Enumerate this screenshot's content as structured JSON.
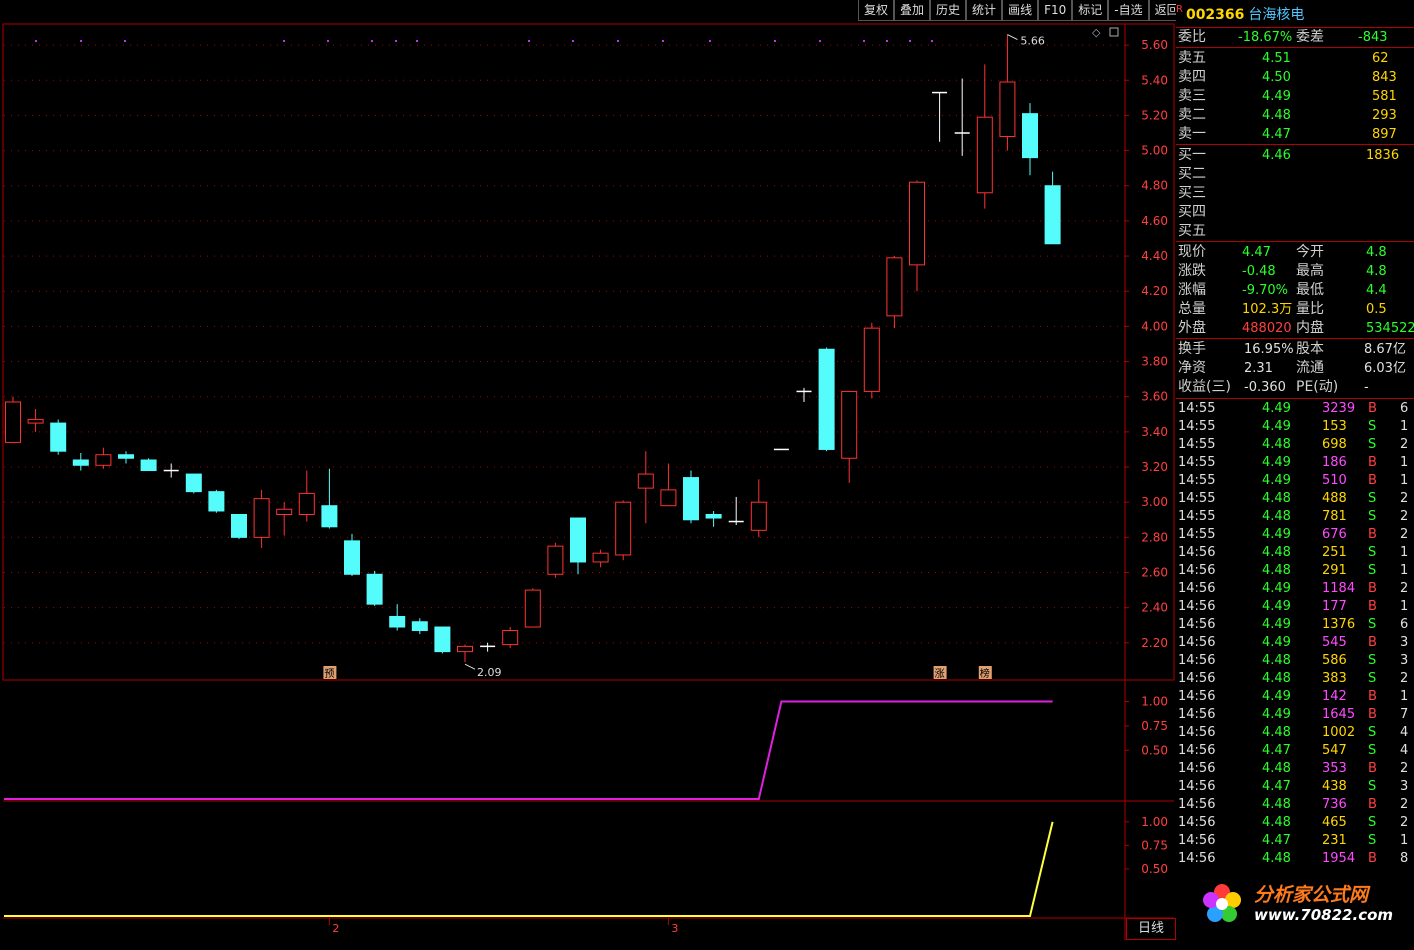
{
  "toolbar": [
    "复权",
    "叠加",
    "历史",
    "统计",
    "画线",
    "F10",
    "标记",
    "-自选",
    "返回"
  ],
  "stock": {
    "tag": "R",
    "code": "002366",
    "name": "台海核电"
  },
  "quote": {
    "weibi_label": "委比",
    "weibi": "-18.67%",
    "weicha_label": "委差",
    "weicha": "-843",
    "asks": [
      {
        "label": "卖五",
        "price": "4.51",
        "vol": "62"
      },
      {
        "label": "卖四",
        "price": "4.50",
        "vol": "843"
      },
      {
        "label": "卖三",
        "price": "4.49",
        "vol": "581"
      },
      {
        "label": "卖二",
        "price": "4.48",
        "vol": "293"
      },
      {
        "label": "卖一",
        "price": "4.47",
        "vol": "897"
      }
    ],
    "bids": [
      {
        "label": "买一",
        "price": "4.46",
        "vol": "1836"
      },
      {
        "label": "买二",
        "price": "",
        "vol": ""
      },
      {
        "label": "买三",
        "price": "",
        "vol": ""
      },
      {
        "label": "买四",
        "price": "",
        "vol": ""
      },
      {
        "label": "买五",
        "price": "",
        "vol": ""
      }
    ],
    "stats": [
      {
        "l1": "现价",
        "v1": "4.47",
        "c1": "g",
        "l2": "今开",
        "v2": "4.8",
        "c2": "g"
      },
      {
        "l1": "涨跌",
        "v1": "-0.48",
        "c1": "g",
        "l2": "最高",
        "v2": "4.8",
        "c2": "g"
      },
      {
        "l1": "涨幅",
        "v1": "-9.70%",
        "c1": "g",
        "l2": "最低",
        "v2": "4.4",
        "c2": "g"
      },
      {
        "l1": "总量",
        "v1": "102.3万",
        "c1": "y",
        "l2": "量比",
        "v2": "0.5",
        "c2": "y"
      },
      {
        "l1": "外盘",
        "v1": "488020",
        "c1": "r",
        "l2": "内盘",
        "v2": "534522",
        "c2": "g"
      }
    ],
    "stats2": [
      {
        "l1": "换手",
        "v1": "16.95%",
        "l2": "股本",
        "v2": "8.67亿"
      },
      {
        "l1": "净资",
        "v1": "2.31",
        "l2": "流通",
        "v2": "6.03亿"
      },
      {
        "l1": "收益(三)",
        "v1": "-0.360",
        "l2": "PE(动)",
        "v2": "-"
      }
    ]
  },
  "ticks": [
    {
      "t": "14:55",
      "p": "4.49",
      "v": "3239",
      "d": "B",
      "n": "6"
    },
    {
      "t": "14:55",
      "p": "4.49",
      "v": "153",
      "d": "S",
      "n": "1"
    },
    {
      "t": "14:55",
      "p": "4.48",
      "v": "698",
      "d": "S",
      "n": "2"
    },
    {
      "t": "14:55",
      "p": "4.49",
      "v": "186",
      "d": "B",
      "n": "1"
    },
    {
      "t": "14:55",
      "p": "4.49",
      "v": "510",
      "d": "B",
      "n": "1"
    },
    {
      "t": "14:55",
      "p": "4.48",
      "v": "488",
      "d": "S",
      "n": "2"
    },
    {
      "t": "14:55",
      "p": "4.48",
      "v": "781",
      "d": "S",
      "n": "2"
    },
    {
      "t": "14:55",
      "p": "4.49",
      "v": "676",
      "d": "B",
      "n": "2"
    },
    {
      "t": "14:56",
      "p": "4.48",
      "v": "251",
      "d": "S",
      "n": "1"
    },
    {
      "t": "14:56",
      "p": "4.48",
      "v": "291",
      "d": "S",
      "n": "1"
    },
    {
      "t": "14:56",
      "p": "4.49",
      "v": "1184",
      "d": "B",
      "n": "2"
    },
    {
      "t": "14:56",
      "p": "4.49",
      "v": "177",
      "d": "B",
      "n": "1"
    },
    {
      "t": "14:56",
      "p": "4.49",
      "v": "1376",
      "d": "S",
      "n": "6"
    },
    {
      "t": "14:56",
      "p": "4.49",
      "v": "545",
      "d": "B",
      "n": "3"
    },
    {
      "t": "14:56",
      "p": "4.48",
      "v": "586",
      "d": "S",
      "n": "3"
    },
    {
      "t": "14:56",
      "p": "4.48",
      "v": "383",
      "d": "S",
      "n": "2"
    },
    {
      "t": "14:56",
      "p": "4.49",
      "v": "142",
      "d": "B",
      "n": "1"
    },
    {
      "t": "14:56",
      "p": "4.49",
      "v": "1645",
      "d": "B",
      "n": "7"
    },
    {
      "t": "14:56",
      "p": "4.48",
      "v": "1002",
      "d": "S",
      "n": "4"
    },
    {
      "t": "14:56",
      "p": "4.47",
      "v": "547",
      "d": "S",
      "n": "4"
    },
    {
      "t": "14:56",
      "p": "4.48",
      "v": "353",
      "d": "B",
      "n": "2"
    },
    {
      "t": "14:56",
      "p": "4.47",
      "v": "438",
      "d": "S",
      "n": "3"
    },
    {
      "t": "14:56",
      "p": "4.48",
      "v": "736",
      "d": "B",
      "n": "2"
    },
    {
      "t": "14:56",
      "p": "4.48",
      "v": "465",
      "d": "S",
      "n": "2"
    },
    {
      "t": "14:56",
      "p": "4.47",
      "v": "231",
      "d": "S",
      "n": "1"
    },
    {
      "t": "14:56",
      "p": "4.48",
      "v": "1954",
      "d": "B",
      "n": "8"
    }
  ],
  "logo": {
    "text": "分析家公式网",
    "url": "www.70822.com"
  },
  "colors": {
    "up": "#ff3232",
    "down": "#54fcfc",
    "grid": "#b00000",
    "magenta": "#e020e0",
    "yellow": "#ffff40"
  },
  "markers": [
    "预",
    "涨",
    "榜"
  ],
  "day_label": "日线",
  "chart_data": {
    "type": "candlestick",
    "ylim": [
      2.0,
      5.72
    ],
    "y_ticks": [
      "5.60",
      "5.40",
      "5.20",
      "5.00",
      "4.80",
      "4.60",
      "4.40",
      "4.20",
      "4.00",
      "3.80",
      "3.60",
      "3.40",
      "3.20",
      "3.00",
      "2.80",
      "2.60",
      "2.40",
      "2.20"
    ],
    "annotations": {
      "high": "5.66",
      "low": "2.09"
    },
    "x_labels": [
      "2",
      "3"
    ],
    "candles": [
      {
        "o": 3.34,
        "h": 3.6,
        "l": 3.34,
        "c": 3.57
      },
      {
        "o": 3.45,
        "h": 3.53,
        "l": 3.4,
        "c": 3.47
      },
      {
        "o": 3.45,
        "h": 3.47,
        "l": 3.27,
        "c": 3.29
      },
      {
        "o": 3.24,
        "h": 3.28,
        "l": 3.18,
        "c": 3.21
      },
      {
        "o": 3.21,
        "h": 3.31,
        "l": 3.19,
        "c": 3.27
      },
      {
        "o": 3.27,
        "h": 3.29,
        "l": 3.22,
        "c": 3.25
      },
      {
        "o": 3.24,
        "h": 3.25,
        "l": 3.18,
        "c": 3.18
      },
      {
        "o": 3.18,
        "h": 3.22,
        "l": 3.14,
        "c": 3.18
      },
      {
        "o": 3.16,
        "h": 3.16,
        "l": 3.05,
        "c": 3.06
      },
      {
        "o": 3.06,
        "h": 3.07,
        "l": 2.94,
        "c": 2.95
      },
      {
        "o": 2.93,
        "h": 2.93,
        "l": 2.79,
        "c": 2.8
      },
      {
        "o": 2.8,
        "h": 3.07,
        "l": 2.74,
        "c": 3.02
      },
      {
        "o": 2.93,
        "h": 3.0,
        "l": 2.81,
        "c": 2.96
      },
      {
        "o": 2.93,
        "h": 3.18,
        "l": 2.89,
        "c": 3.05
      },
      {
        "o": 2.98,
        "h": 3.19,
        "l": 2.85,
        "c": 2.86
      },
      {
        "o": 2.78,
        "h": 2.82,
        "l": 2.58,
        "c": 2.59
      },
      {
        "o": 2.59,
        "h": 2.61,
        "l": 2.41,
        "c": 2.42
      },
      {
        "o": 2.35,
        "h": 2.42,
        "l": 2.27,
        "c": 2.29
      },
      {
        "o": 2.32,
        "h": 2.34,
        "l": 2.25,
        "c": 2.27
      },
      {
        "o": 2.29,
        "h": 2.29,
        "l": 2.14,
        "c": 2.15
      },
      {
        "o": 2.15,
        "h": 2.19,
        "l": 2.09,
        "c": 2.18
      },
      {
        "o": 2.17,
        "h": 2.2,
        "l": 2.15,
        "c": 2.18
      },
      {
        "o": 2.19,
        "h": 2.29,
        "l": 2.17,
        "c": 2.27
      },
      {
        "o": 2.29,
        "h": 2.51,
        "l": 2.29,
        "c": 2.5
      },
      {
        "o": 2.59,
        "h": 2.77,
        "l": 2.57,
        "c": 2.75
      },
      {
        "o": 2.91,
        "h": 2.91,
        "l": 2.59,
        "c": 2.66
      },
      {
        "o": 2.66,
        "h": 2.73,
        "l": 2.63,
        "c": 2.71
      },
      {
        "o": 2.7,
        "h": 3.01,
        "l": 2.67,
        "c": 3.0
      },
      {
        "o": 3.08,
        "h": 3.29,
        "l": 2.88,
        "c": 3.16
      },
      {
        "o": 2.98,
        "h": 3.22,
        "l": 2.98,
        "c": 3.07
      },
      {
        "o": 3.14,
        "h": 3.18,
        "l": 2.88,
        "c": 2.9
      },
      {
        "o": 2.93,
        "h": 2.95,
        "l": 2.86,
        "c": 2.91
      },
      {
        "o": 2.89,
        "h": 3.03,
        "l": 2.87,
        "c": 2.89
      },
      {
        "o": 2.84,
        "h": 3.13,
        "l": 2.8,
        "c": 3.0
      },
      {
        "o": 3.3,
        "h": 3.3,
        "l": 3.3,
        "c": 3.3
      },
      {
        "o": 3.63,
        "h": 3.65,
        "l": 3.57,
        "c": 3.63
      },
      {
        "o": 3.87,
        "h": 3.88,
        "l": 3.29,
        "c": 3.3
      },
      {
        "o": 3.25,
        "h": 3.63,
        "l": 3.11,
        "c": 3.63
      },
      {
        "o": 3.63,
        "h": 4.02,
        "l": 3.59,
        "c": 3.99
      },
      {
        "o": 4.06,
        "h": 4.4,
        "l": 3.99,
        "c": 4.39
      },
      {
        "o": 4.35,
        "h": 4.83,
        "l": 4.2,
        "c": 4.82
      },
      {
        "o": 5.33,
        "h": 5.33,
        "l": 5.05,
        "c": 5.33
      },
      {
        "o": 5.1,
        "h": 5.41,
        "l": 4.97,
        "c": 5.1
      },
      {
        "o": 4.76,
        "h": 5.49,
        "l": 4.67,
        "c": 5.19
      },
      {
        "o": 5.08,
        "h": 5.66,
        "l": 5.0,
        "c": 5.39
      },
      {
        "o": 5.21,
        "h": 5.27,
        "l": 4.86,
        "c": 4.96
      },
      {
        "o": 4.8,
        "h": 4.88,
        "l": 4.47,
        "c": 4.47
      }
    ],
    "indicator1": {
      "ylim": [
        0,
        1.2
      ],
      "y_ticks": [
        "1.00",
        "0.75",
        "0.50"
      ],
      "values": [
        0,
        0,
        0,
        0,
        0,
        0,
        0,
        0,
        0,
        0,
        0,
        0,
        0,
        0,
        0,
        0,
        0,
        0,
        0,
        0,
        0,
        0,
        0,
        0,
        0,
        0,
        0,
        0,
        0,
        0,
        0,
        0,
        0,
        0,
        1,
        1,
        1,
        1,
        1,
        1,
        1,
        1,
        1,
        1,
        1,
        1,
        1
      ]
    },
    "indicator2": {
      "ylim": [
        0,
        1.2
      ],
      "y_ticks": [
        "1.00",
        "0.75",
        "0.50"
      ],
      "values": [
        0,
        0,
        0,
        0,
        0,
        0,
        0,
        0,
        0,
        0,
        0,
        0,
        0,
        0,
        0,
        0,
        0,
        0,
        0,
        0,
        0,
        0,
        0,
        0,
        0,
        0,
        0,
        0,
        0,
        0,
        0,
        0,
        0,
        0,
        0,
        0,
        0,
        0,
        0,
        0,
        0,
        0,
        0,
        0,
        0,
        0,
        1
      ]
    }
  }
}
